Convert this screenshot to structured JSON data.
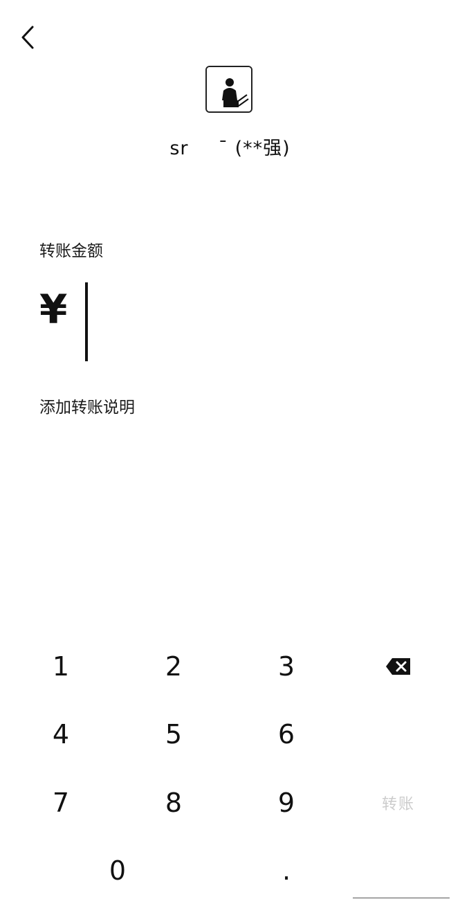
{
  "header": {
    "back_icon": "chevron-left-icon"
  },
  "recipient": {
    "avatar_icon": "person-avatar",
    "nickname": "sr      ̄",
    "real_name_masked": "(**强)"
  },
  "amount_section": {
    "label": "转账金额",
    "currency_symbol": "¥",
    "value": ""
  },
  "remark": {
    "label": "添加转账说明"
  },
  "keypad": {
    "keys": [
      "1",
      "2",
      "3",
      "4",
      "5",
      "6",
      "7",
      "8",
      "9",
      "0",
      "."
    ],
    "delete_icon": "backspace-icon",
    "confirm_label": "转账"
  }
}
